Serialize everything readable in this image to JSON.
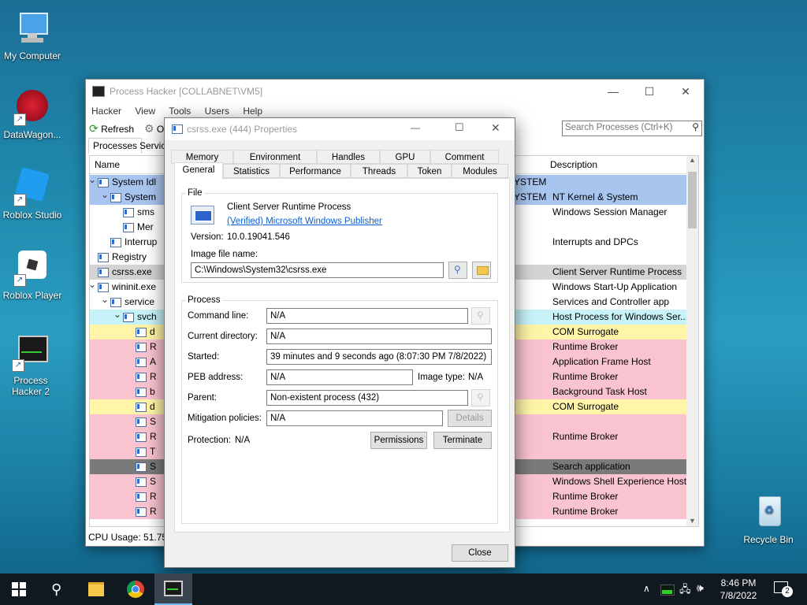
{
  "desktop": {
    "icons": [
      {
        "label": "My Computer"
      },
      {
        "label": "DataWagon..."
      },
      {
        "label": "Roblox Studio"
      },
      {
        "label": "Roblox Player"
      },
      {
        "label": "Process Hacker 2"
      },
      {
        "label": "Recycle Bin"
      }
    ]
  },
  "main_window": {
    "title": "Process Hacker [COLLABNET\\VM5]",
    "menu": [
      "Hacker",
      "View",
      "Tools",
      "Users",
      "Help"
    ],
    "toolbar": {
      "refresh": "Refresh",
      "options_partial": "O"
    },
    "search_placeholder": "Search Processes (Ctrl+K)",
    "tabs": [
      "Processes",
      "Service"
    ],
    "columns": {
      "name": "Name",
      "user_partial": "",
      "description": "Description"
    },
    "rows": [
      {
        "name": "System Idl",
        "user": "YSTEM",
        "desc": "",
        "bg": "#a8c5f0"
      },
      {
        "name": "System",
        "user": "YSTEM",
        "desc": "NT Kernel & System",
        "bg": "#a8c5f0"
      },
      {
        "name": "sms",
        "user": "",
        "desc": "Windows Session Manager",
        "bg": "#ffffff"
      },
      {
        "name": "Mer",
        "user": "",
        "desc": "",
        "bg": "#ffffff"
      },
      {
        "name": "Interrup",
        "user": "",
        "desc": "Interrupts and DPCs",
        "bg": "#ffffff"
      },
      {
        "name": "Registry",
        "user": "",
        "desc": "",
        "bg": "#ffffff"
      },
      {
        "name": "csrss.exe",
        "user": "",
        "desc": "Client Server Runtime Process",
        "bg": "#d4d4d4"
      },
      {
        "name": "wininit.exe",
        "user": "",
        "desc": "Windows Start-Up Application",
        "bg": "#ffffff"
      },
      {
        "name": "service",
        "user": "",
        "desc": "Services and Controller app",
        "bg": "#ffffff"
      },
      {
        "name": "svch",
        "user": "",
        "desc": "Host Process for Windows Ser...",
        "bg": "#c6f2f8"
      },
      {
        "name": "d",
        "user": "",
        "desc": "COM Surrogate",
        "bg": "#fff5a8"
      },
      {
        "name": "R",
        "user": "",
        "desc": "Runtime Broker",
        "bg": "#f9c3cf"
      },
      {
        "name": "A",
        "user": "",
        "desc": "Application Frame Host",
        "bg": "#f9c3cf"
      },
      {
        "name": "R",
        "user": "",
        "desc": "Runtime Broker",
        "bg": "#f9c3cf"
      },
      {
        "name": "b",
        "user": "",
        "desc": "Background Task Host",
        "bg": "#f9c3cf"
      },
      {
        "name": "d",
        "user": "",
        "desc": "COM Surrogate",
        "bg": "#fff5a8"
      },
      {
        "name": "S",
        "user": "",
        "desc": "",
        "bg": "#f9c3cf"
      },
      {
        "name": "R",
        "user": "",
        "desc": "Runtime Broker",
        "bg": "#f9c3cf"
      },
      {
        "name": "T",
        "user": "",
        "desc": "",
        "bg": "#f9c3cf"
      },
      {
        "name": "S",
        "user": "",
        "desc": "Search application",
        "bg": "#7a7a7a"
      },
      {
        "name": "S",
        "user": "",
        "desc": "Windows Shell Experience Host",
        "bg": "#f9c3cf"
      },
      {
        "name": "R",
        "user": "",
        "desc": "Runtime Broker",
        "bg": "#f9c3cf"
      },
      {
        "name": "R",
        "user": "",
        "desc": "Runtime Broker",
        "bg": "#f9c3cf"
      }
    ],
    "status": "CPU Usage: 51.75%"
  },
  "dialog": {
    "title": "csrss.exe (444) Properties",
    "tabs_top": [
      "Memory",
      "Environment",
      "Handles",
      "GPU",
      "Comment"
    ],
    "tabs_bottom": [
      "General",
      "Statistics",
      "Performance",
      "Threads",
      "Token",
      "Modules"
    ],
    "file": {
      "group": "File",
      "description": "Client Server Runtime Process",
      "publisher": "(Verified) Microsoft Windows Publisher",
      "version_label": "Version:",
      "version": "10.0.19041.546",
      "image_label": "Image file name:",
      "image_path": "C:\\Windows\\System32\\csrss.exe"
    },
    "process": {
      "group": "Process",
      "cmd_label": "Command line:",
      "cmd": "N/A",
      "cwd_label": "Current directory:",
      "cwd": "N/A",
      "started_label": "Started:",
      "started": "39 minutes and 9 seconds ago (8:07:30 PM 7/8/2022)",
      "peb_label": "PEB address:",
      "peb": "N/A",
      "imgtype_label": "Image type:",
      "imgtype": "N/A",
      "parent_label": "Parent:",
      "parent": "Non-existent process (432)",
      "mitigation_label": "Mitigation policies:",
      "mitigation": "N/A",
      "details_btn": "Details",
      "protection_label": "Protection:",
      "protection": "N/A",
      "permissions_btn": "Permissions",
      "terminate_btn": "Terminate"
    },
    "close_btn": "Close"
  },
  "taskbar": {
    "time": "8:46 PM",
    "date": "7/8/2022",
    "notifications": "2"
  }
}
